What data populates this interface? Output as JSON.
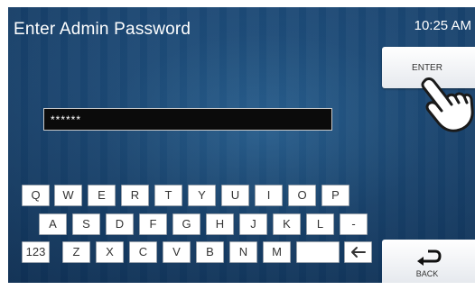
{
  "header": {
    "title": "Enter Admin Password",
    "time": "10:25 AM"
  },
  "password": {
    "masked_value": "******"
  },
  "buttons": {
    "enter_label": "ENTER",
    "back_label": "BACK"
  },
  "icons": {
    "enter_hand": "pointing-hand-icon",
    "back": "return-arrow-icon",
    "backspace": "left-arrow-icon"
  },
  "keyboard": {
    "row1": [
      "Q",
      "W",
      "E",
      "R",
      "T",
      "Y",
      "U",
      "I",
      "O",
      "P"
    ],
    "row2": [
      "A",
      "S",
      "D",
      "F",
      "G",
      "H",
      "J",
      "K",
      "L",
      "-"
    ],
    "row3": [
      "123",
      "Z",
      "X",
      "C",
      "V",
      "B",
      "N",
      "M"
    ]
  },
  "colors": {
    "background": "#1e4d7a",
    "field_bg": "#0b0b0b",
    "key_bg": "#ffffff"
  }
}
